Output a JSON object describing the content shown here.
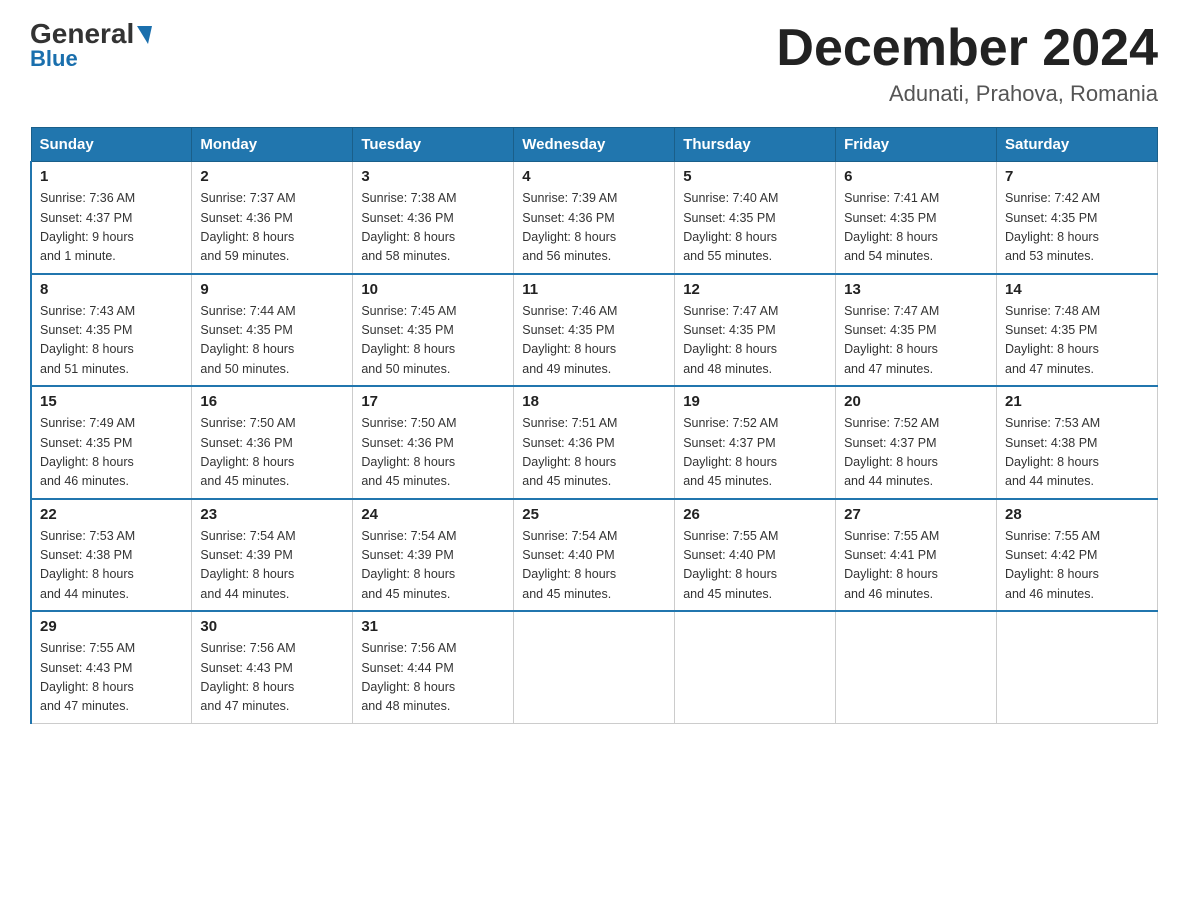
{
  "logo": {
    "general": "General",
    "blue": "Blue",
    "triangle": "▼"
  },
  "header": {
    "month": "December 2024",
    "location": "Adunati, Prahova, Romania"
  },
  "days_of_week": [
    "Sunday",
    "Monday",
    "Tuesday",
    "Wednesday",
    "Thursday",
    "Friday",
    "Saturday"
  ],
  "weeks": [
    [
      {
        "day": "1",
        "sunrise": "7:36 AM",
        "sunset": "4:37 PM",
        "daylight": "9 hours and 1 minute."
      },
      {
        "day": "2",
        "sunrise": "7:37 AM",
        "sunset": "4:36 PM",
        "daylight": "8 hours and 59 minutes."
      },
      {
        "day": "3",
        "sunrise": "7:38 AM",
        "sunset": "4:36 PM",
        "daylight": "8 hours and 58 minutes."
      },
      {
        "day": "4",
        "sunrise": "7:39 AM",
        "sunset": "4:36 PM",
        "daylight": "8 hours and 56 minutes."
      },
      {
        "day": "5",
        "sunrise": "7:40 AM",
        "sunset": "4:35 PM",
        "daylight": "8 hours and 55 minutes."
      },
      {
        "day": "6",
        "sunrise": "7:41 AM",
        "sunset": "4:35 PM",
        "daylight": "8 hours and 54 minutes."
      },
      {
        "day": "7",
        "sunrise": "7:42 AM",
        "sunset": "4:35 PM",
        "daylight": "8 hours and 53 minutes."
      }
    ],
    [
      {
        "day": "8",
        "sunrise": "7:43 AM",
        "sunset": "4:35 PM",
        "daylight": "8 hours and 51 minutes."
      },
      {
        "day": "9",
        "sunrise": "7:44 AM",
        "sunset": "4:35 PM",
        "daylight": "8 hours and 50 minutes."
      },
      {
        "day": "10",
        "sunrise": "7:45 AM",
        "sunset": "4:35 PM",
        "daylight": "8 hours and 50 minutes."
      },
      {
        "day": "11",
        "sunrise": "7:46 AM",
        "sunset": "4:35 PM",
        "daylight": "8 hours and 49 minutes."
      },
      {
        "day": "12",
        "sunrise": "7:47 AM",
        "sunset": "4:35 PM",
        "daylight": "8 hours and 48 minutes."
      },
      {
        "day": "13",
        "sunrise": "7:47 AM",
        "sunset": "4:35 PM",
        "daylight": "8 hours and 47 minutes."
      },
      {
        "day": "14",
        "sunrise": "7:48 AM",
        "sunset": "4:35 PM",
        "daylight": "8 hours and 47 minutes."
      }
    ],
    [
      {
        "day": "15",
        "sunrise": "7:49 AM",
        "sunset": "4:35 PM",
        "daylight": "8 hours and 46 minutes."
      },
      {
        "day": "16",
        "sunrise": "7:50 AM",
        "sunset": "4:36 PM",
        "daylight": "8 hours and 45 minutes."
      },
      {
        "day": "17",
        "sunrise": "7:50 AM",
        "sunset": "4:36 PM",
        "daylight": "8 hours and 45 minutes."
      },
      {
        "day": "18",
        "sunrise": "7:51 AM",
        "sunset": "4:36 PM",
        "daylight": "8 hours and 45 minutes."
      },
      {
        "day": "19",
        "sunrise": "7:52 AM",
        "sunset": "4:37 PM",
        "daylight": "8 hours and 45 minutes."
      },
      {
        "day": "20",
        "sunrise": "7:52 AM",
        "sunset": "4:37 PM",
        "daylight": "8 hours and 44 minutes."
      },
      {
        "day": "21",
        "sunrise": "7:53 AM",
        "sunset": "4:38 PM",
        "daylight": "8 hours and 44 minutes."
      }
    ],
    [
      {
        "day": "22",
        "sunrise": "7:53 AM",
        "sunset": "4:38 PM",
        "daylight": "8 hours and 44 minutes."
      },
      {
        "day": "23",
        "sunrise": "7:54 AM",
        "sunset": "4:39 PM",
        "daylight": "8 hours and 44 minutes."
      },
      {
        "day": "24",
        "sunrise": "7:54 AM",
        "sunset": "4:39 PM",
        "daylight": "8 hours and 45 minutes."
      },
      {
        "day": "25",
        "sunrise": "7:54 AM",
        "sunset": "4:40 PM",
        "daylight": "8 hours and 45 minutes."
      },
      {
        "day": "26",
        "sunrise": "7:55 AM",
        "sunset": "4:40 PM",
        "daylight": "8 hours and 45 minutes."
      },
      {
        "day": "27",
        "sunrise": "7:55 AM",
        "sunset": "4:41 PM",
        "daylight": "8 hours and 46 minutes."
      },
      {
        "day": "28",
        "sunrise": "7:55 AM",
        "sunset": "4:42 PM",
        "daylight": "8 hours and 46 minutes."
      }
    ],
    [
      {
        "day": "29",
        "sunrise": "7:55 AM",
        "sunset": "4:43 PM",
        "daylight": "8 hours and 47 minutes."
      },
      {
        "day": "30",
        "sunrise": "7:56 AM",
        "sunset": "4:43 PM",
        "daylight": "8 hours and 47 minutes."
      },
      {
        "day": "31",
        "sunrise": "7:56 AM",
        "sunset": "4:44 PM",
        "daylight": "8 hours and 48 minutes."
      },
      null,
      null,
      null,
      null
    ]
  ],
  "labels": {
    "sunrise": "Sunrise:",
    "sunset": "Sunset:",
    "daylight": "Daylight:"
  }
}
